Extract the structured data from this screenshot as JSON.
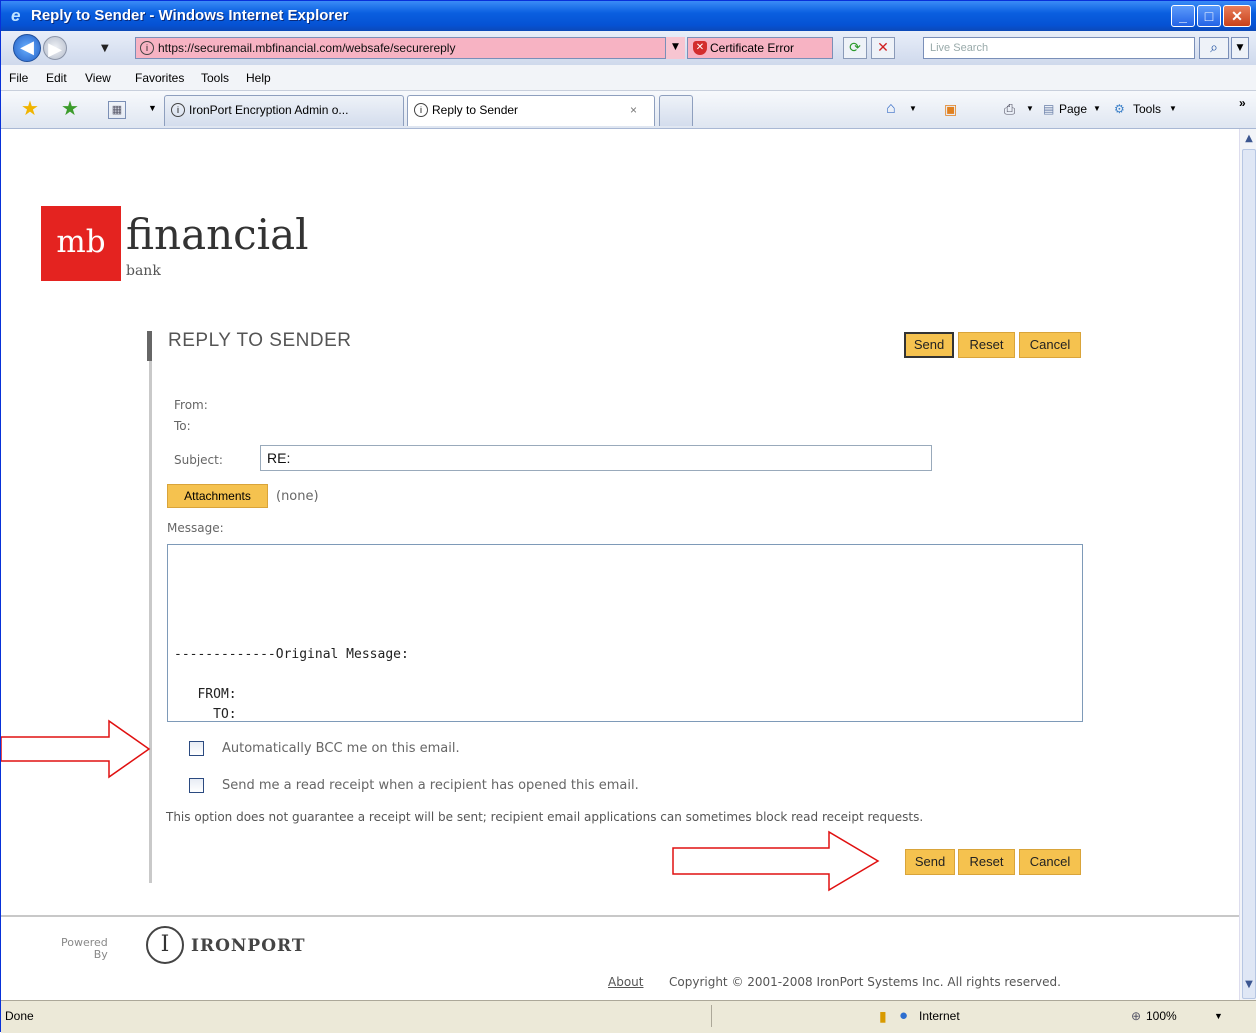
{
  "window": {
    "title": "Reply to Sender - Windows Internet Explorer"
  },
  "address_bar": {
    "url": "https://securemail.mbfinancial.com/websafe/securereply",
    "cert_error": "Certificate Error",
    "search_placeholder": "Live Search"
  },
  "menu": {
    "items": [
      "File",
      "Edit",
      "View",
      "Favorites",
      "Tools",
      "Help"
    ]
  },
  "tabs": [
    {
      "label": "IronPort Encryption Admin o..."
    },
    {
      "label": "Reply to Sender",
      "close": "×"
    }
  ],
  "toolbar": {
    "page": "Page",
    "tools": "Tools",
    "more": "»"
  },
  "logo": {
    "box": "mb",
    "word": "financial",
    "sub": "bank"
  },
  "form": {
    "title": "REPLY TO SENDER",
    "buttons": {
      "send": "Send",
      "reset": "Reset",
      "cancel": "Cancel"
    },
    "from_label": "From:",
    "to_label": "To:",
    "subject_label": "Subject:",
    "subject_value": "RE:",
    "attachments_button": "Attachments",
    "attachments_value": "(none)",
    "message_label": "Message:",
    "message_body": "\n\n\n\n\n-------------Original Message:\n\n   FROM:\n     TO:",
    "bcc_label": "Automatically BCC me on this email.",
    "receipt_label": "Send me a read receipt when a recipient has opened this email.",
    "receipt_note": "This option does not guarantee a receipt will be sent; recipient email applications can sometimes block read receipt requests."
  },
  "footer": {
    "powered": "Powered",
    "by": "By",
    "brand_mark": "I",
    "brand": "IRONPORT",
    "about": "About",
    "copyright": "Copyright © 2001-2008 IronPort Systems Inc. All rights reserved."
  },
  "status": {
    "text": "Done",
    "zone": "Internet",
    "zoom": "100%"
  },
  "colors": {
    "accent_button": "#f5c24f",
    "logo_red": "#e42320",
    "arrow": "#e01010",
    "url_error_bg": "#f7b3c3"
  }
}
